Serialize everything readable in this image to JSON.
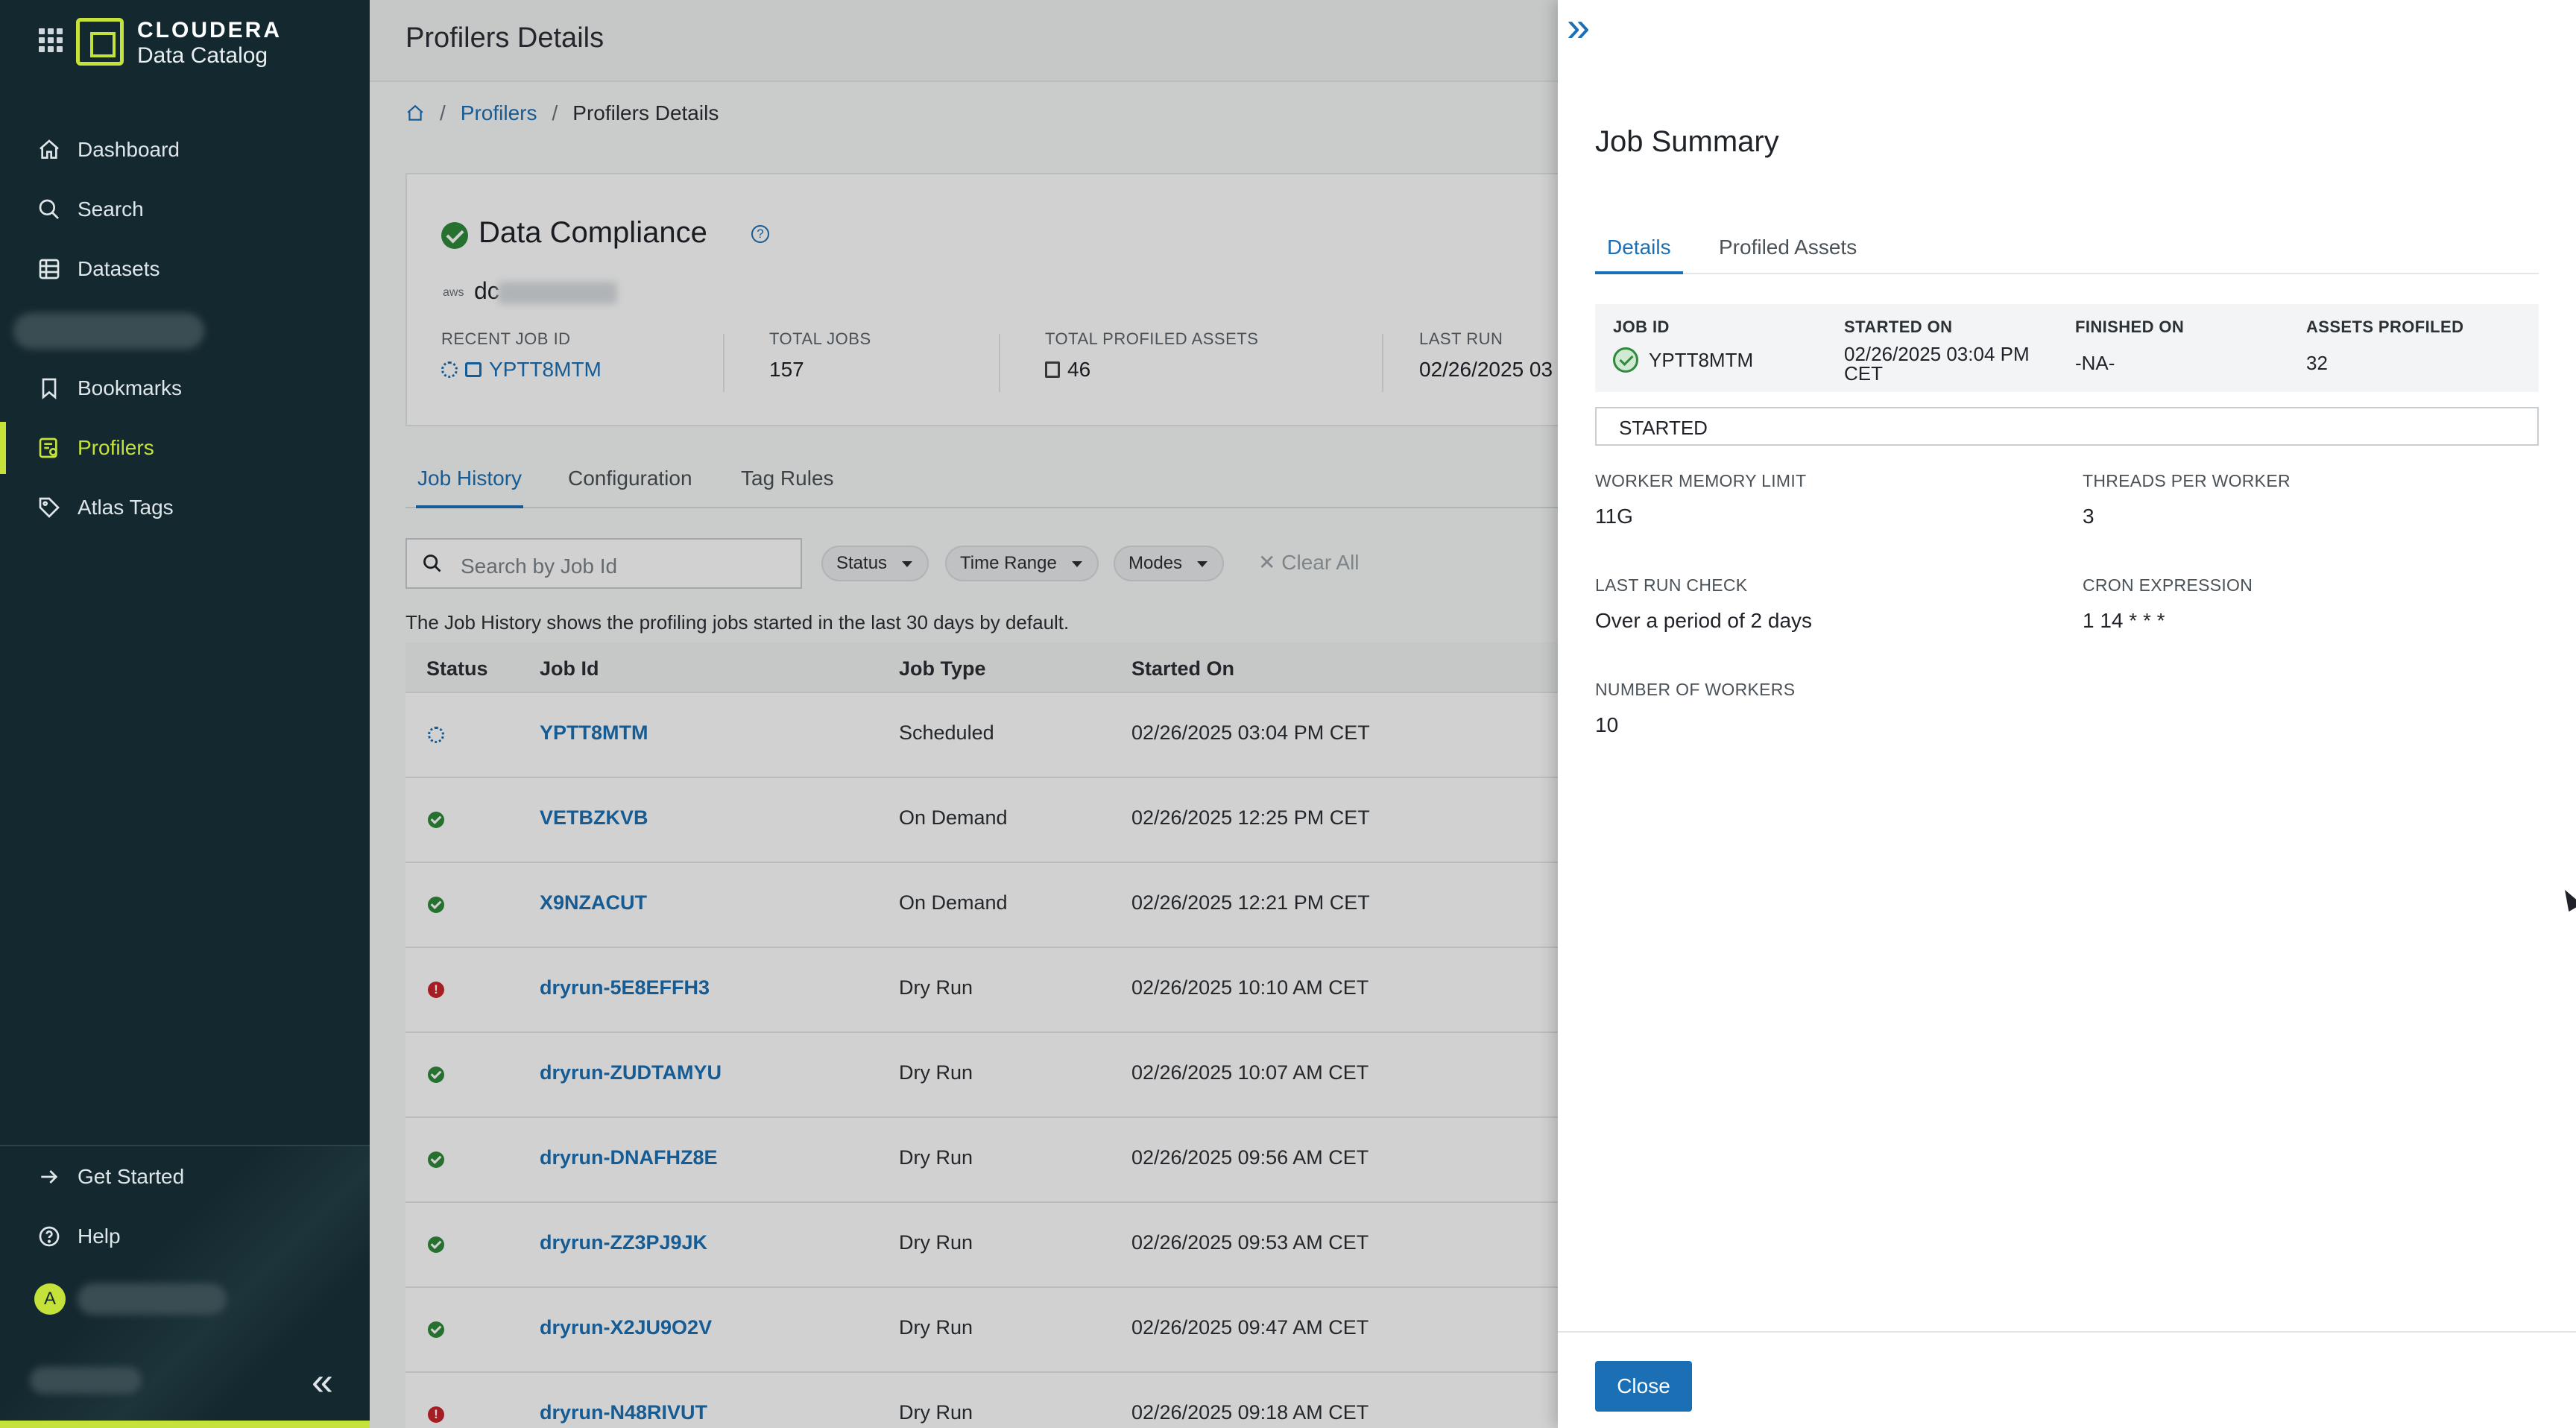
{
  "brand": {
    "line1": "CLOUDERA",
    "line2": "Data Catalog"
  },
  "sidebar": {
    "items": [
      {
        "label": "Dashboard",
        "icon": "home-icon"
      },
      {
        "label": "Search",
        "icon": "search-icon"
      },
      {
        "label": "Datasets",
        "icon": "datasets-icon"
      },
      {
        "label": "Bookmarks",
        "icon": "bookmark-icon"
      },
      {
        "label": "Profilers",
        "icon": "profilers-icon",
        "active": true
      },
      {
        "label": "Atlas Tags",
        "icon": "tag-icon"
      }
    ],
    "bottom": [
      {
        "label": "Get Started",
        "icon": "arrow-right-icon"
      },
      {
        "label": "Help",
        "icon": "help-icon"
      }
    ],
    "avatar_initial": "A",
    "accent": "#c5e23a"
  },
  "header": {
    "title": "Profilers Details"
  },
  "breadcrumb": {
    "parent": "Profilers",
    "current": "Profilers Details",
    "separator": "/"
  },
  "profiler": {
    "name": "Data Compliance",
    "source_prefix": "dc",
    "cloud": "aws",
    "stats": {
      "recent_job_id_label": "RECENT JOB ID",
      "recent_job_id": "YPTT8MTM",
      "total_jobs_label": "TOTAL JOBS",
      "total_jobs": "157",
      "total_profiled_assets_label": "TOTAL PROFILED ASSETS",
      "total_profiled_assets": "46",
      "last_run_label": "LAST RUN",
      "last_run": "02/26/2025 03"
    }
  },
  "tabs": [
    "Job History",
    "Configuration",
    "Tag Rules"
  ],
  "filters": {
    "search_placeholder": "Search by Job Id",
    "chips": [
      "Status",
      "Time Range",
      "Modes"
    ],
    "clear_all": "Clear All",
    "note": "The Job History shows the profiling jobs started in the last 30 days by default."
  },
  "table": {
    "columns": [
      "Status",
      "Job Id",
      "Job Type",
      "Started On"
    ],
    "rows": [
      {
        "status": "running",
        "id": "YPTT8MTM",
        "type": "Scheduled",
        "started": "02/26/2025 03:04 PM CET"
      },
      {
        "status": "success",
        "id": "VETBZKVB",
        "type": "On Demand",
        "started": "02/26/2025 12:25 PM CET"
      },
      {
        "status": "success",
        "id": "X9NZACUT",
        "type": "On Demand",
        "started": "02/26/2025 12:21 PM CET"
      },
      {
        "status": "error",
        "id": "dryrun-5E8EFFH3",
        "type": "Dry Run",
        "started": "02/26/2025 10:10 AM CET"
      },
      {
        "status": "success",
        "id": "dryrun-ZUDTAMYU",
        "type": "Dry Run",
        "started": "02/26/2025 10:07 AM CET"
      },
      {
        "status": "success",
        "id": "dryrun-DNAFHZ8E",
        "type": "Dry Run",
        "started": "02/26/2025 09:56 AM CET"
      },
      {
        "status": "success",
        "id": "dryrun-ZZ3PJ9JK",
        "type": "Dry Run",
        "started": "02/26/2025 09:53 AM CET"
      },
      {
        "status": "success",
        "id": "dryrun-X2JU9O2V",
        "type": "Dry Run",
        "started": "02/26/2025 09:47 AM CET"
      },
      {
        "status": "error",
        "id": "dryrun-N48RIVUT",
        "type": "Dry Run",
        "started": "02/26/2025 09:18 AM CET"
      }
    ]
  },
  "drawer": {
    "title": "Job Summary",
    "tabs": [
      "Details",
      "Profiled Assets"
    ],
    "summary": {
      "job_id_label": "JOB ID",
      "job_id": "YPTT8MTM",
      "started_on_label": "STARTED ON",
      "started_on_line1": "02/26/2025 03:04 PM",
      "started_on_line2": "CET",
      "finished_on_label": "FINISHED ON",
      "finished_on": "-NA-",
      "assets_profiled_label": "ASSETS PROFILED",
      "assets_profiled": "32"
    },
    "status": "STARTED",
    "fields": {
      "worker_memory_limit_label": "WORKER MEMORY LIMIT",
      "worker_memory_limit": "11G",
      "threads_per_worker_label": "THREADS PER WORKER",
      "threads_per_worker": "3",
      "last_run_check_label": "LAST RUN CHECK",
      "last_run_check": "Over a period of 2 days",
      "cron_expression_label": "CRON EXPRESSION",
      "cron_expression": "1 14 * * *",
      "number_of_workers_label": "NUMBER OF WORKERS",
      "number_of_workers": "10"
    },
    "close_label": "Close",
    "accent": "#1a6fb5"
  }
}
